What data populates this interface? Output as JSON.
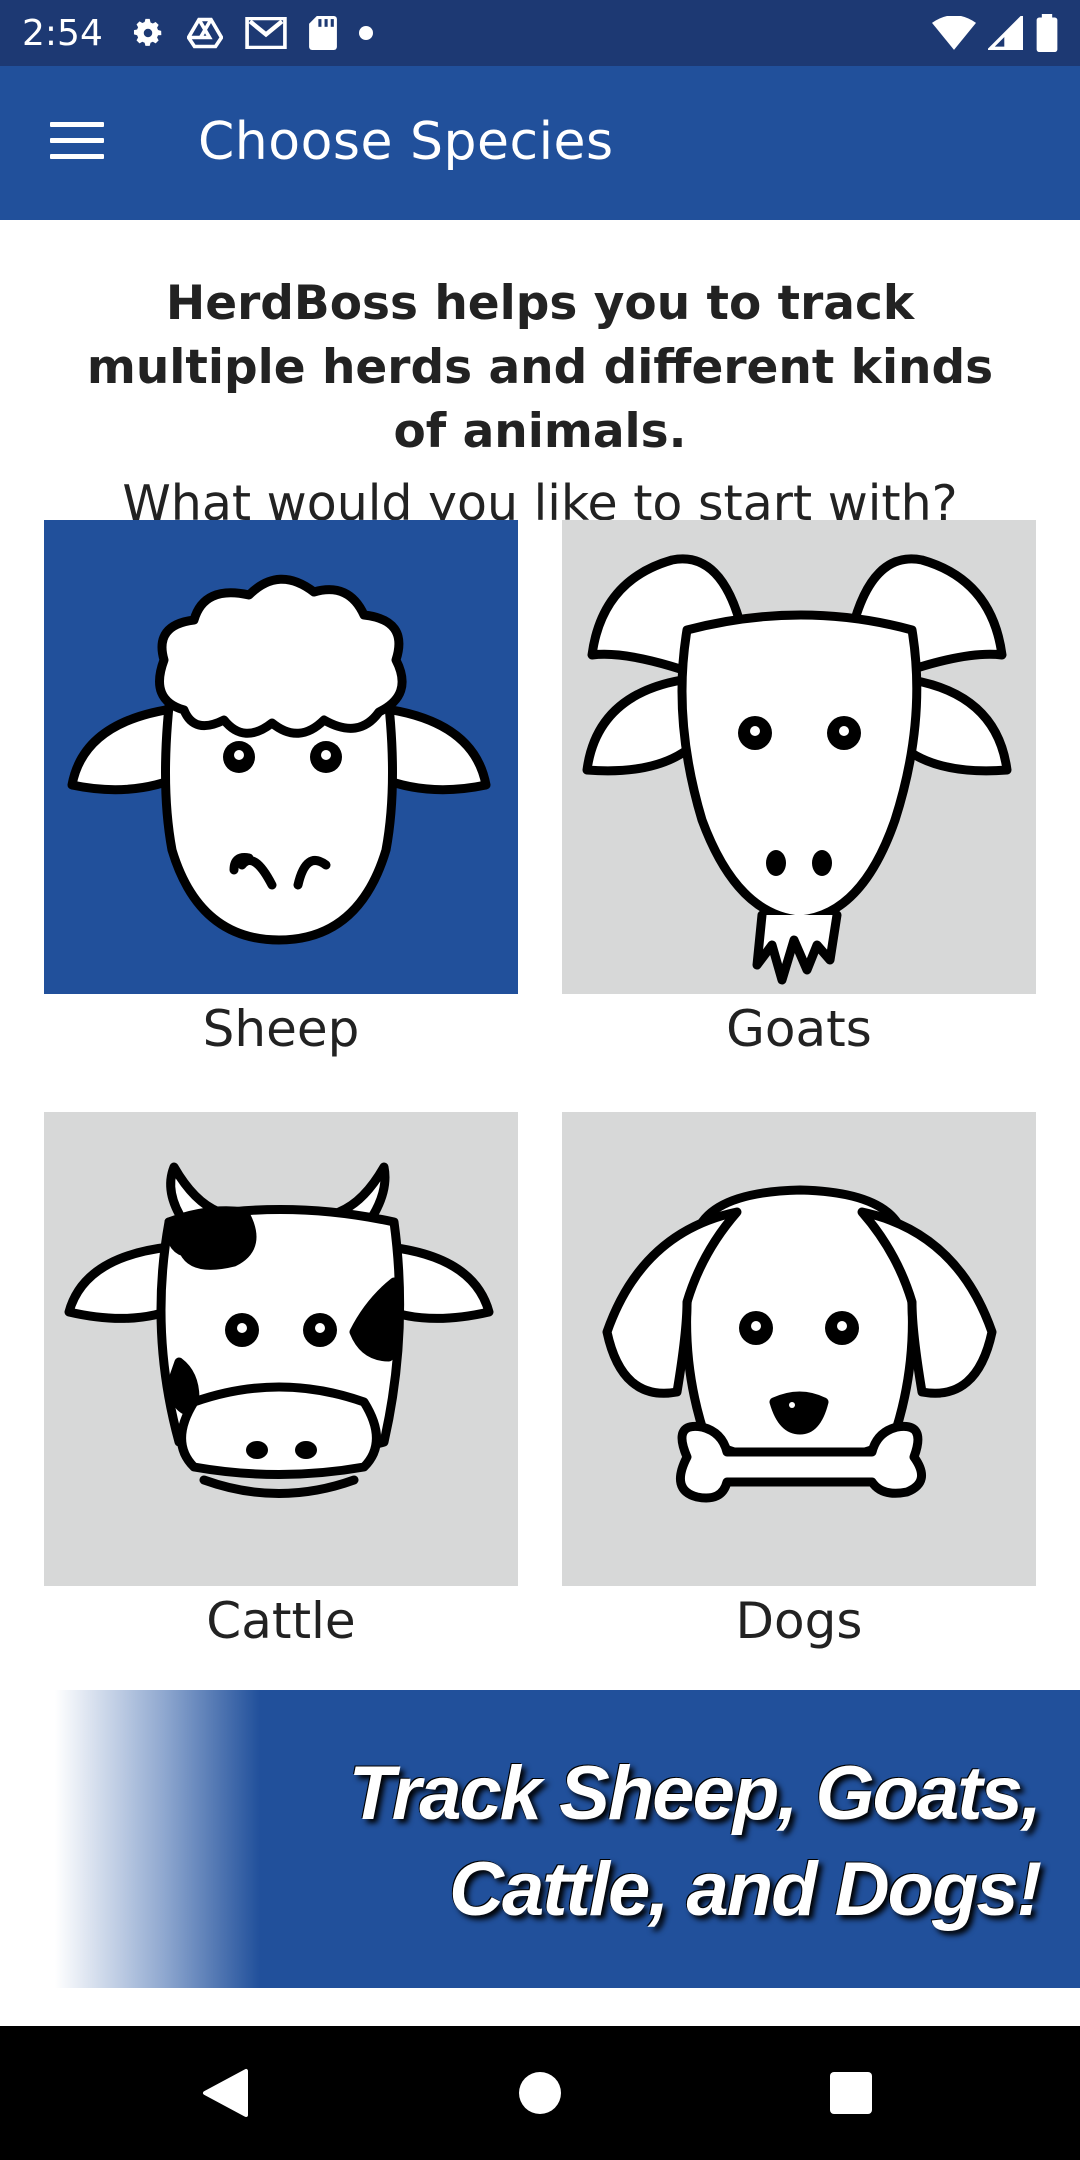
{
  "status_bar": {
    "time": "2:54",
    "left_icons": [
      "gear-icon",
      "drive-icon",
      "gmail-icon",
      "sd-card-icon",
      "dot-icon"
    ],
    "right_icons": [
      "wifi-icon",
      "signal-icon",
      "battery-icon"
    ]
  },
  "app_bar": {
    "title": "Choose Species",
    "menu_icon": "hamburger-menu-icon"
  },
  "intro": {
    "headline": "HerdBoss helps you to track multiple herds and different kinds of animals.",
    "question": "What would you like to start with?"
  },
  "species": [
    {
      "label": "Sheep",
      "icon": "sheep-icon",
      "selected": true
    },
    {
      "label": "Goats",
      "icon": "goat-icon",
      "selected": false
    },
    {
      "label": "Cattle",
      "icon": "cow-icon",
      "selected": false
    },
    {
      "label": "Dogs",
      "icon": "dog-icon",
      "selected": false
    }
  ],
  "banner": {
    "text": "Track Sheep, Goats,\nCattle, and Dogs!"
  },
  "nav_bar": {
    "buttons": [
      "back-icon",
      "home-icon",
      "recents-icon"
    ]
  },
  "colors": {
    "status_bar": "#1d3973",
    "app_bar": "#21509b",
    "selected_tile": "#21509b",
    "unselected_tile": "#d7d8d8"
  }
}
